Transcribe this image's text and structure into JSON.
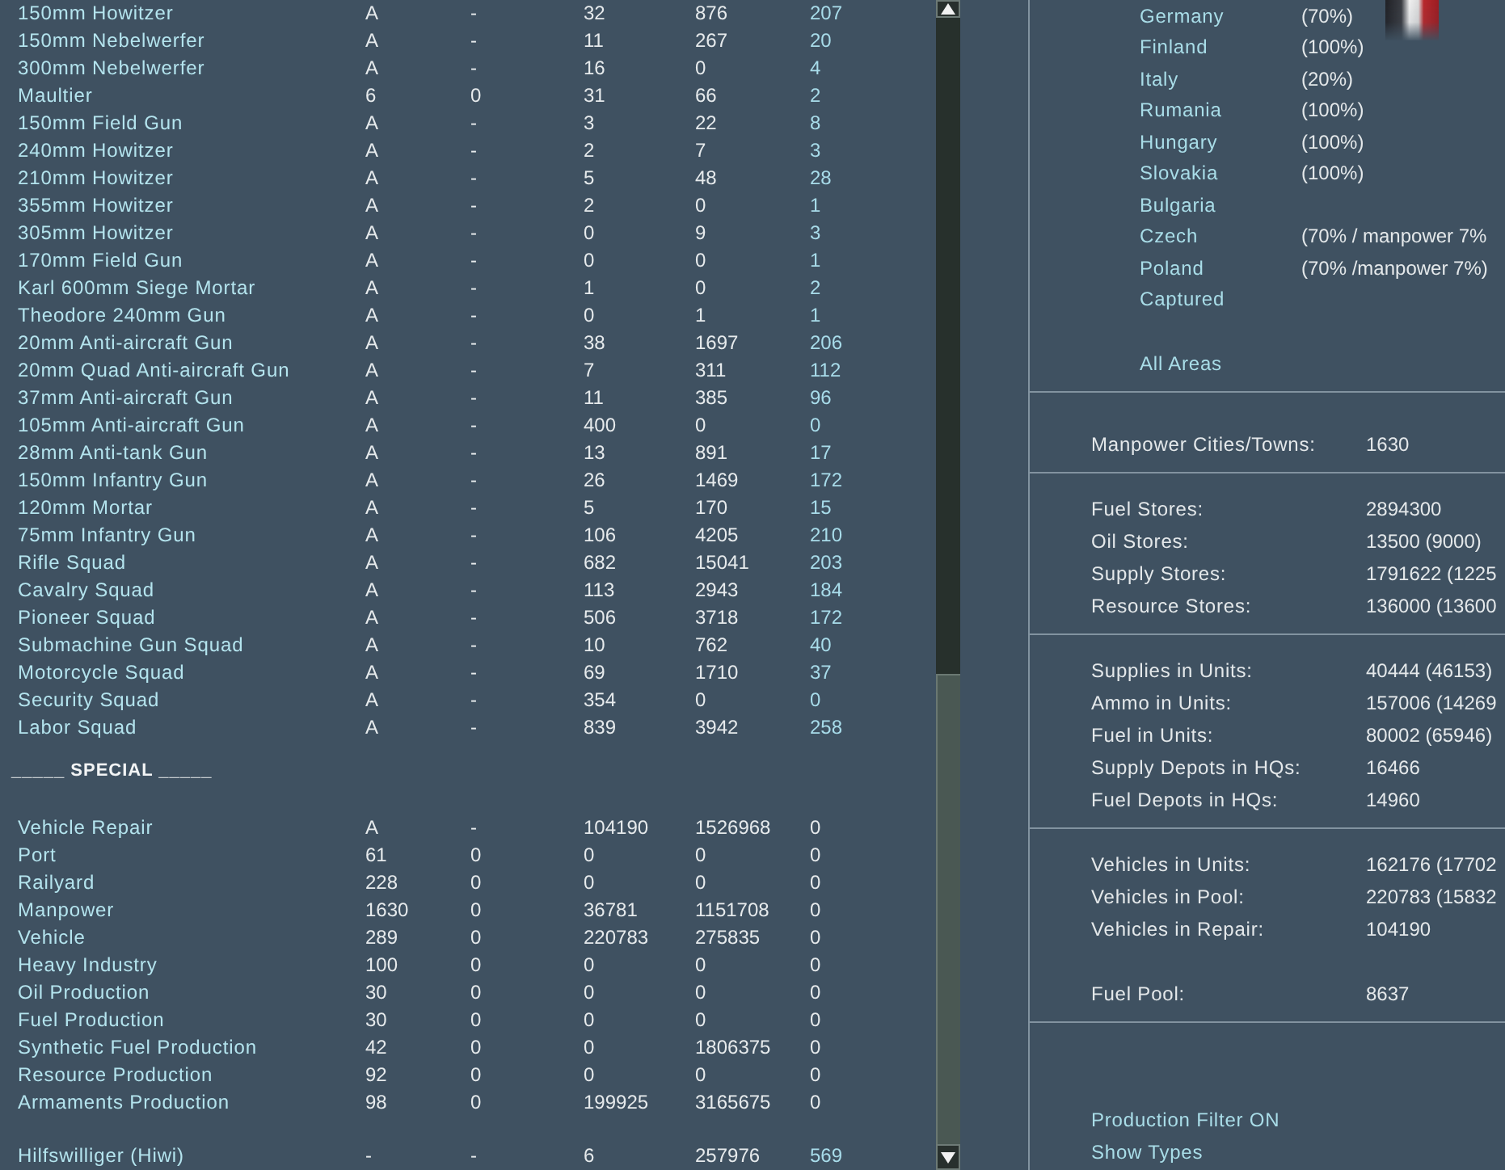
{
  "unit_rows": [
    {
      "cells": [
        "150mm Howitzer",
        "A",
        "-",
        "32",
        "876",
        "207"
      ]
    },
    {
      "cells": [
        "150mm Nebelwerfer",
        "A",
        "-",
        "11",
        "267",
        "20"
      ]
    },
    {
      "cells": [
        "300mm Nebelwerfer",
        "A",
        "-",
        "16",
        "0",
        "4"
      ]
    },
    {
      "cells": [
        "Maultier",
        "6",
        "0",
        "31",
        "66",
        "2"
      ]
    },
    {
      "cells": [
        "150mm Field Gun",
        "A",
        "-",
        "3",
        "22",
        "8"
      ]
    },
    {
      "cells": [
        "240mm Howitzer",
        "A",
        "-",
        "2",
        "7",
        "3"
      ]
    },
    {
      "cells": [
        "210mm Howitzer",
        "A",
        "-",
        "5",
        "48",
        "28"
      ]
    },
    {
      "cells": [
        "355mm Howitzer",
        "A",
        "-",
        "2",
        "0",
        "1"
      ]
    },
    {
      "cells": [
        "305mm Howitzer",
        "A",
        "-",
        "0",
        "9",
        "3"
      ]
    },
    {
      "cells": [
        "170mm Field Gun",
        "A",
        "-",
        "0",
        "0",
        "1"
      ]
    },
    {
      "cells": [
        "Karl 600mm Siege Mortar",
        "A",
        "-",
        "1",
        "0",
        "2"
      ]
    },
    {
      "cells": [
        "Theodore 240mm Gun",
        "A",
        "-",
        "0",
        "1",
        "1"
      ]
    },
    {
      "cells": [
        "20mm Anti-aircraft Gun",
        "A",
        "-",
        "38",
        "1697",
        "206"
      ]
    },
    {
      "cells": [
        "20mm Quad Anti-aircraft Gun",
        "A",
        "-",
        "7",
        "311",
        "112"
      ]
    },
    {
      "cells": [
        "37mm Anti-aircraft Gun",
        "A",
        "-",
        "11",
        "385",
        "96"
      ]
    },
    {
      "cells": [
        "105mm Anti-aircraft Gun",
        "A",
        "-",
        "400",
        "0",
        "0"
      ]
    },
    {
      "cells": [
        "28mm Anti-tank Gun",
        "A",
        "-",
        "13",
        "891",
        "17"
      ]
    },
    {
      "cells": [
        "150mm Infantry Gun",
        "A",
        "-",
        "26",
        "1469",
        "172"
      ]
    },
    {
      "cells": [
        "120mm Mortar",
        "A",
        "-",
        "5",
        "170",
        "15"
      ]
    },
    {
      "cells": [
        "75mm Infantry Gun",
        "A",
        "-",
        "106",
        "4205",
        "210"
      ]
    },
    {
      "cells": [
        "Rifle Squad",
        "A",
        "-",
        "682",
        "15041",
        "203"
      ]
    },
    {
      "cells": [
        "Cavalry Squad",
        "A",
        "-",
        "113",
        "2943",
        "184"
      ]
    },
    {
      "cells": [
        "Pioneer Squad",
        "A",
        "-",
        "506",
        "3718",
        "172"
      ]
    },
    {
      "cells": [
        "Submachine Gun Squad",
        "A",
        "-",
        "10",
        "762",
        "40"
      ]
    },
    {
      "cells": [
        "Motorcycle Squad",
        "A",
        "-",
        "69",
        "1710",
        "37"
      ]
    },
    {
      "cells": [
        "Security Squad",
        "A",
        "-",
        "354",
        "0",
        "0"
      ]
    },
    {
      "cells": [
        "Labor Squad",
        "A",
        "-",
        "839",
        "3942",
        "258"
      ]
    }
  ],
  "special_heading": "_____ SPECIAL _____",
  "special_rows": [
    {
      "cells": [
        "Vehicle Repair",
        "A",
        "-",
        "104190",
        "1526968",
        "0"
      ]
    },
    {
      "cells": [
        "Port",
        "61",
        "0",
        "0",
        "0",
        "0"
      ]
    },
    {
      "cells": [
        "Railyard",
        "228",
        "0",
        "0",
        "0",
        "0"
      ]
    },
    {
      "cells": [
        "Manpower",
        "1630",
        "0",
        "36781",
        "1151708",
        "0"
      ]
    },
    {
      "cells": [
        "Vehicle",
        "289",
        "0",
        "220783",
        "275835",
        "0"
      ]
    },
    {
      "cells": [
        "Heavy Industry",
        "100",
        "0",
        "0",
        "0",
        "0"
      ]
    },
    {
      "cells": [
        "Oil Production",
        "30",
        "0",
        "0",
        "0",
        "0"
      ]
    },
    {
      "cells": [
        "Fuel Production",
        "30",
        "0",
        "0",
        "0",
        "0"
      ]
    },
    {
      "cells": [
        "Synthetic Fuel Production",
        "42",
        "0",
        "0",
        "1806375",
        "0"
      ]
    },
    {
      "cells": [
        "Resource Production",
        "92",
        "0",
        "0",
        "0",
        "0"
      ]
    },
    {
      "cells": [
        "Armaments Production",
        "98",
        "0",
        "199925",
        "3165675",
        "0"
      ]
    }
  ],
  "extra_rows": [
    {
      "cells": [
        "Hilfswilliger (Hiwi)",
        "-",
        "-",
        "6",
        "257976",
        "569"
      ]
    }
  ],
  "nations": [
    {
      "name": "Germany",
      "share": "(70%)"
    },
    {
      "name": "Finland",
      "share": "(100%)"
    },
    {
      "name": "Italy",
      "share": "(20%)"
    },
    {
      "name": "Rumania",
      "share": "(100%)"
    },
    {
      "name": "Hungary",
      "share": "(100%)"
    },
    {
      "name": "Slovakia",
      "share": "(100%)"
    },
    {
      "name": "Bulgaria"
    },
    {
      "name": "Czech",
      "share": "(70% / manpower 7%"
    },
    {
      "name": "Poland",
      "share": "(70% /manpower 7%)"
    },
    {
      "name": "Captured"
    }
  ],
  "all_areas": "All Areas",
  "stat_sections": [
    {
      "groups": [
        [
          {
            "label": "Manpower Cities/Towns:",
            "value": "1630"
          }
        ]
      ]
    },
    {
      "groups": [
        [
          {
            "label": "Fuel Stores:",
            "value": "2894300"
          },
          {
            "label": "Oil Stores:",
            "value": "13500 (9000)"
          },
          {
            "label": "Supply Stores:",
            "value": "1791622 (1225"
          },
          {
            "label": "Resource Stores:",
            "value": "136000 (13600"
          }
        ]
      ]
    },
    {
      "groups": [
        [
          {
            "label": "Supplies in Units:",
            "value": "40444 (46153)"
          },
          {
            "label": "Ammo in Units:",
            "value": "157006 (14269"
          },
          {
            "label": "Fuel in Units:",
            "value": "80002 (65946)"
          },
          {
            "label": "Supply Depots in HQs:",
            "value": "16466"
          },
          {
            "label": "Fuel Depots in HQs:",
            "value": "14960"
          }
        ]
      ]
    },
    {
      "groups": [
        [
          {
            "label": "Vehicles in Units:",
            "value": "162176 (17702"
          },
          {
            "label": "Vehicles in Pool:",
            "value": "220783 (15832"
          },
          {
            "label": "Vehicles in Repair:",
            "value": "104190"
          }
        ],
        [
          {
            "label": "Fuel Pool:",
            "value": "8637"
          }
        ]
      ]
    }
  ],
  "links": [
    "Production Filter ON",
    "Show Types"
  ]
}
